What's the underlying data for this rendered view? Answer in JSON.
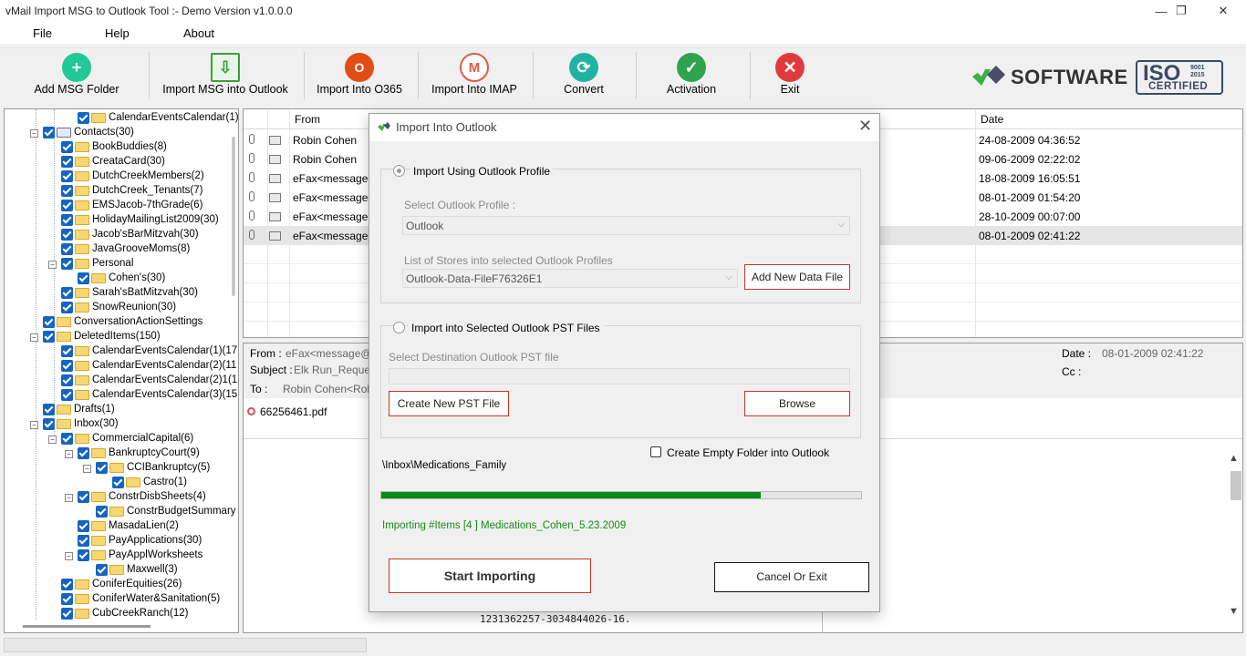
{
  "window": {
    "title": "vMail Import MSG to Outlook Tool  :- Demo Version v1.0.0.0",
    "minimize": "—",
    "restore": "❐",
    "close": "✕"
  },
  "menu": [
    "File",
    "Help",
    "About"
  ],
  "toolbar": {
    "buttons": [
      {
        "label": "Add MSG Folder",
        "icon": "plus-icon",
        "color": "#20c997"
      },
      {
        "label": "Import MSG into Outlook",
        "icon": "import-icon",
        "color": "#3aa13a"
      },
      {
        "label": "Import Into O365",
        "icon": "office-icon",
        "color": "#e14d15"
      },
      {
        "label": "Import Into IMAP",
        "icon": "gmail-icon",
        "color": "#e05a4c"
      },
      {
        "label": "Convert",
        "icon": "convert-icon",
        "color": "#20b3a3"
      },
      {
        "label": "Activation",
        "icon": "check-icon",
        "color": "#2ea44f"
      },
      {
        "label": "Exit",
        "icon": "close-icon",
        "color": "#e03a3e"
      }
    ],
    "logo_text": "SOFTWARE",
    "iso": {
      "big": "ISO",
      "small": [
        "9001",
        "2015"
      ],
      "cert": "CERTIFIED"
    }
  },
  "tree": {
    "items": [
      {
        "label": "CalendarEventsCalendar(1)(18",
        "level": 3
      },
      {
        "label": "Contacts(30)",
        "level": 1,
        "expanded": true,
        "contacts": true
      },
      {
        "label": "BookBuddies(8)",
        "level": 2
      },
      {
        "label": "CreataCard(30)",
        "level": 2
      },
      {
        "label": "DutchCreekMembers(2)",
        "level": 2
      },
      {
        "label": "DutchCreek_Tenants(7)",
        "level": 2
      },
      {
        "label": "EMSJacob-7thGrade(6)",
        "level": 2
      },
      {
        "label": "HolidayMailingList2009(30)",
        "level": 2
      },
      {
        "label": "Jacob'sBarMitzvah(30)",
        "level": 2
      },
      {
        "label": "JavaGrooveMoms(8)",
        "level": 2
      },
      {
        "label": "Personal",
        "level": 2,
        "expanded": true
      },
      {
        "label": "Cohen's(30)",
        "level": 3
      },
      {
        "label": "Sarah'sBatMitzvah(30)",
        "level": 2
      },
      {
        "label": "SnowReunion(30)",
        "level": 2
      },
      {
        "label": "ConversationActionSettings",
        "level": 1
      },
      {
        "label": "DeletedItems(150)",
        "level": 1,
        "expanded": true
      },
      {
        "label": "CalendarEventsCalendar(1)(17",
        "level": 2
      },
      {
        "label": "CalendarEventsCalendar(2)(11",
        "level": 2
      },
      {
        "label": "CalendarEventsCalendar(2)1(1",
        "level": 2
      },
      {
        "label": "CalendarEventsCalendar(3)(15",
        "level": 2
      },
      {
        "label": "Drafts(1)",
        "level": 1
      },
      {
        "label": "Inbox(30)",
        "level": 1,
        "expanded": true
      },
      {
        "label": "CommercialCapital(6)",
        "level": 2,
        "expanded": true
      },
      {
        "label": "BankruptcyCourt(9)",
        "level": 3,
        "expanded": true
      },
      {
        "label": "CCIBankruptcy(5)",
        "level": 4,
        "expanded": true
      },
      {
        "label": "Castro(1)",
        "level": 5
      },
      {
        "label": "ConstrDisbSheets(4)",
        "level": 3,
        "expanded": true
      },
      {
        "label": "ConstrBudgetSummary",
        "level": 4
      },
      {
        "label": "MasadaLien(2)",
        "level": 3
      },
      {
        "label": "PayApplications(30)",
        "level": 3
      },
      {
        "label": "PayApplWorksheets",
        "level": 3,
        "expanded": true
      },
      {
        "label": "Maxwell(3)",
        "level": 4
      },
      {
        "label": "ConiferEquities(26)",
        "level": 2
      },
      {
        "label": "ConiferWater&Sanitation(5)",
        "level": 2
      },
      {
        "label": "CubCreekRanch(12)",
        "level": 2
      }
    ]
  },
  "maillist": {
    "columns": {
      "from": "From",
      "date": "Date"
    },
    "rows": [
      {
        "from": "Robin Cohen",
        "date": "24-08-2009 04:36:52"
      },
      {
        "from": "Robin Cohen",
        "date": "09-06-2009 02:22:02"
      },
      {
        "from": "eFax<message@i",
        "date": "18-08-2009 16:05:51"
      },
      {
        "from": "eFax<message@i",
        "date": "08-01-2009 01:54:20"
      },
      {
        "from": "eFax<message@i",
        "date": "28-10-2009 00:07:00"
      },
      {
        "from": "eFax<message@i",
        "date": "08-01-2009 02:41:22"
      }
    ]
  },
  "preview": {
    "from_label": "From :",
    "from_value": "eFax<message@in",
    "subject_label": "Subject :",
    "subject_value": "Elk Run_Request",
    "to_label": "To :",
    "to_value": "Robin Cohen<Robin",
    "date_label": "Date :",
    "date_value": "08-01-2009 02:41:22",
    "cc_label": "Cc :",
    "attachment": "66256461.pdf",
    "body_text": "1231362257-3034844026-16."
  },
  "dialog": {
    "title": "Import Into Outlook",
    "close": "✕",
    "opt1_label": "Import Using Outlook Profile",
    "select_profile_label": "Select Outlook Profile :",
    "profile_value": "Outlook",
    "stores_label": "List of Stores into selected Outlook Profiles",
    "store_value": "Outlook-Data-FileF76326E1",
    "add_data_file": "Add New Data File",
    "opt2_label": "Import into Selected Outlook PST Files",
    "dest_pst_label": "Select Destination Outlook PST file",
    "dest_pst_value": "",
    "create_pst": "Create New PST File",
    "browse": "Browse",
    "create_empty_folder": "Create Empty Folder into Outlook",
    "current_path": "\\Inbox\\Medications_Family",
    "progress_fraction": 0.79,
    "status_text": "Importing #Items [4 ] Medications_Cohen_5.23.2009",
    "start": "Start Importing",
    "cancel": "Cancel Or Exit"
  }
}
